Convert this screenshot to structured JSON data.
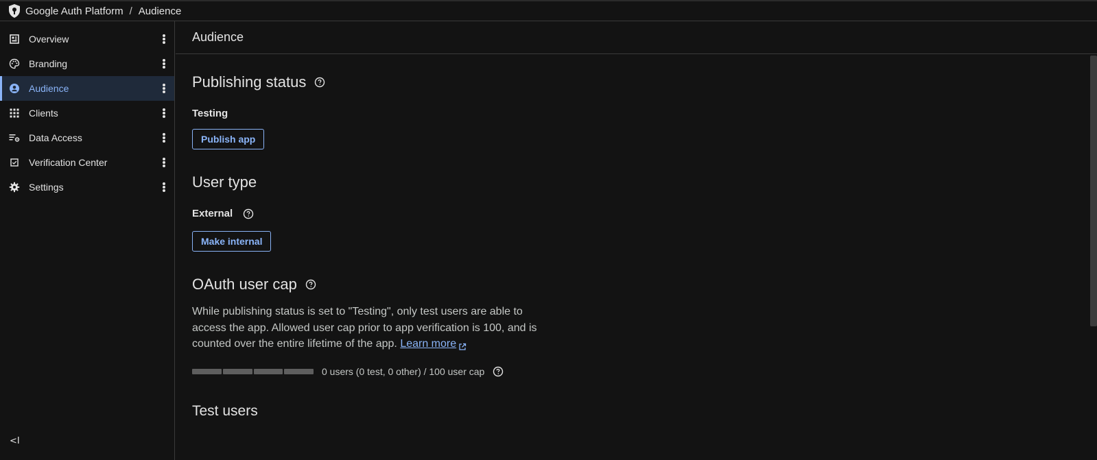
{
  "breadcrumb": {
    "app": "Google Auth Platform",
    "separator": "/",
    "current": "Audience"
  },
  "sidebar": {
    "items": [
      {
        "label": "Overview",
        "icon": "dashboard-icon",
        "active": false
      },
      {
        "label": "Branding",
        "icon": "palette-icon",
        "active": false
      },
      {
        "label": "Audience",
        "icon": "account-circle-icon",
        "active": true
      },
      {
        "label": "Clients",
        "icon": "apps-grid-icon",
        "active": false
      },
      {
        "label": "Data Access",
        "icon": "data-settings-icon",
        "active": false
      },
      {
        "label": "Verification Center",
        "icon": "verified-checkbox-icon",
        "active": false
      },
      {
        "label": "Settings",
        "icon": "gear-icon",
        "active": false
      }
    ],
    "collapse_label": "<I"
  },
  "page": {
    "title": "Audience"
  },
  "publishing": {
    "heading": "Publishing status",
    "status": "Testing",
    "button": "Publish app"
  },
  "user_type": {
    "heading": "User type",
    "value": "External",
    "button": "Make internal"
  },
  "user_cap": {
    "heading": "OAuth user cap",
    "description": "While publishing status is set to \"Testing\", only test users are able to access the app. Allowed user cap prior to app verification is 100, and is counted over the entire lifetime of the app.",
    "link": "Learn more",
    "progress_fraction": 0,
    "progress_text": "0 users (0 test, 0 other) / 100 user cap"
  },
  "test_users": {
    "heading": "Test users"
  },
  "colors": {
    "accent": "#8ab4f8",
    "background": "#131313",
    "active_nav_bg": "#1f2a3a"
  }
}
